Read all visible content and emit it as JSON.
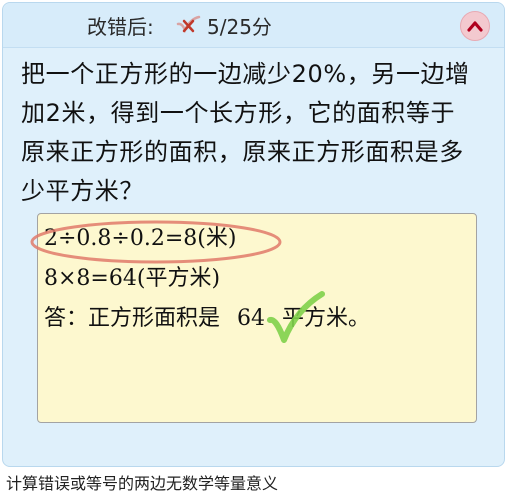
{
  "header": {
    "label": "改错后:",
    "wrong_icon": "red-cross-check-icon",
    "score": "5/25分",
    "collapse_icon": "chevron-up-icon"
  },
  "question": {
    "text": "把一个正方形的一边减少20%，另一边增加2米，得到一个长方形，它的面积等于原来正方形的面积，原来正方形面积是多少平方米？"
  },
  "answer": {
    "line1": "2÷0.8÷0.2=8(米)",
    "line2": "8×8=64(平方米)",
    "line3_prefix": "答：正方形面积是",
    "line3_value": "64",
    "line3_suffix": "平方米。",
    "error_mark": "red-ellipse-highlight",
    "correct_mark": "green-check-icon"
  },
  "colors": {
    "card_bg": "#dff0fb",
    "answer_bg": "#fdf8cf",
    "error_red": "#e07a6a",
    "correct_green": "#7fd04a"
  },
  "footer": {
    "note": "计算错误或等号的两边无数学等量意义"
  }
}
